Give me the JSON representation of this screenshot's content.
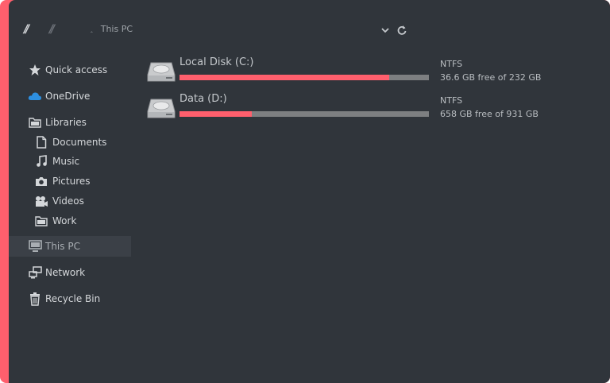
{
  "colors": {
    "accent": "#ff5f6d",
    "background": "#30353b",
    "bar_track": "#7d7f81"
  },
  "corner_glyph": "//",
  "toolbar": {
    "back_icon": "//",
    "forward_icon": "//"
  },
  "address": {
    "path": "This PC"
  },
  "sidebar": {
    "quick_access": "Quick access",
    "onedrive": "OneDrive",
    "libraries": "Libraries",
    "documents": "Documents",
    "music": "Music",
    "pictures": "Pictures",
    "videos": "Videos",
    "work": "Work",
    "this_pc": "This PC",
    "network": "Network",
    "recycle_bin": "Recycle Bin"
  },
  "drives": [
    {
      "name": "Local Disk (C:)",
      "filesystem": "NTFS",
      "free_text": "36.6 GB free of 232 GB",
      "used_fraction": 0.84
    },
    {
      "name": "Data (D:)",
      "filesystem": "NTFS",
      "free_text": "658 GB free of 931 GB",
      "used_fraction": 0.29
    }
  ]
}
